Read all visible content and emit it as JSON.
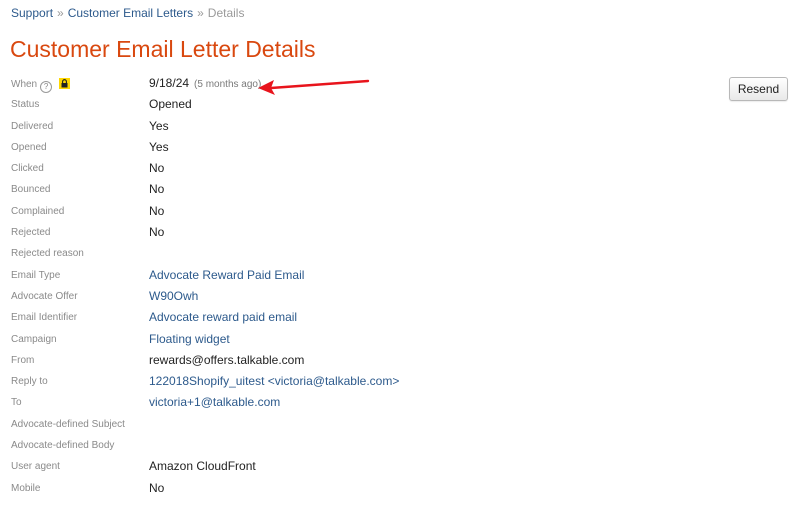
{
  "breadcrumb": {
    "items": [
      "Support",
      "Customer Email Letters"
    ],
    "separator": "»",
    "current": "Details"
  },
  "page": {
    "title": "Customer Email Letter Details",
    "title_color": "#d9480f"
  },
  "actions": {
    "resend_label": "Resend"
  },
  "help_icon": "?",
  "when": {
    "label": "When",
    "value": "9/18/24",
    "relative": "(5 months ago)",
    "icons": [
      "help-icon",
      "lock-icon"
    ]
  },
  "annotation": {
    "type": "red-arrow",
    "color": "#e8141c"
  },
  "fields": [
    {
      "label": "Status",
      "value": "Opened",
      "link": false
    },
    {
      "label": "Delivered",
      "value": "Yes",
      "link": false
    },
    {
      "label": "Opened",
      "value": "Yes",
      "link": false
    },
    {
      "label": "Clicked",
      "value": "No",
      "link": false
    },
    {
      "label": "Bounced",
      "value": "No",
      "link": false
    },
    {
      "label": "Complained",
      "value": "No",
      "link": false
    },
    {
      "label": "Rejected",
      "value": "No",
      "link": false
    },
    {
      "label": "Rejected reason",
      "value": "",
      "link": false
    },
    {
      "label": "Email Type",
      "value": "Advocate Reward Paid Email",
      "link": true
    },
    {
      "label": "Advocate Offer",
      "value": "W90Owh",
      "link": true
    },
    {
      "label": "Email Identifier",
      "value": "Advocate reward paid email",
      "link": true
    },
    {
      "label": "Campaign",
      "value": "Floating widget",
      "link": true
    },
    {
      "label": "From",
      "value": "rewards@offers.talkable.com",
      "link": false
    },
    {
      "label": "Reply to",
      "value": "122018Shopify_uitest <victoria@talkable.com>",
      "link": true
    },
    {
      "label": "To",
      "value": "victoria+1@talkable.com",
      "link": true
    },
    {
      "label": "Advocate-defined Subject",
      "value": "",
      "link": false
    },
    {
      "label": "Advocate-defined Body",
      "value": "",
      "link": false
    },
    {
      "label": "User agent",
      "value": "Amazon CloudFront",
      "link": false
    },
    {
      "label": "Mobile",
      "value": "No",
      "link": false
    }
  ]
}
